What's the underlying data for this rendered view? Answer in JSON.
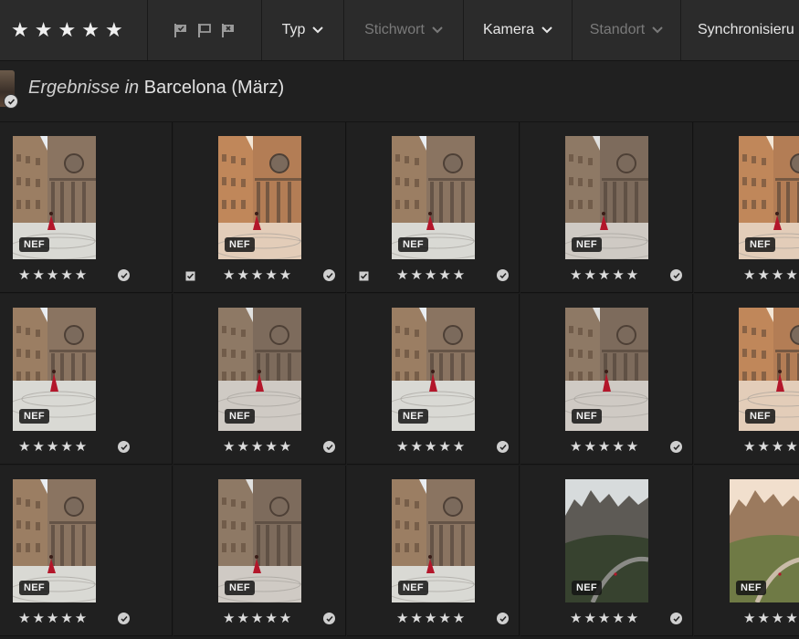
{
  "filter_bar": {
    "stars": [
      "★",
      "★",
      "★",
      "★",
      "★"
    ],
    "flag_icons": [
      "picked-flag-icon",
      "unflagged-icon",
      "rejected-flag-icon"
    ],
    "dropdowns": [
      {
        "label": "Typ",
        "dim": false
      },
      {
        "label": "Stichwort",
        "dim": true
      },
      {
        "label": "Kamera",
        "dim": false
      },
      {
        "label": "Standort",
        "dim": true
      }
    ],
    "sync_label": "Synchronisieru"
  },
  "title": {
    "prefix": "Ergebnisse in",
    "album": "Barcelona (März)"
  },
  "photos": [
    {
      "badge": "NEF",
      "rating": "★★★★★",
      "scene": "plaza",
      "tone": "cool",
      "picked": false
    },
    {
      "badge": "NEF",
      "rating": "★★★★★",
      "scene": "plaza",
      "tone": "warm",
      "picked": true
    },
    {
      "badge": "NEF",
      "rating": "★★★★★",
      "scene": "plaza",
      "tone": "cool",
      "picked": true
    },
    {
      "badge": "NEF",
      "rating": "★★★★★",
      "scene": "plaza",
      "tone": "muted",
      "picked": false
    },
    {
      "badge": "NEF",
      "rating": "★★★★★",
      "scene": "plaza",
      "tone": "warm",
      "picked": false
    },
    {
      "badge": "NEF",
      "rating": "★★★★★",
      "scene": "plaza2",
      "tone": "cool",
      "picked": false
    },
    {
      "badge": "NEF",
      "rating": "★★★★★",
      "scene": "plaza2",
      "tone": "muted",
      "picked": false
    },
    {
      "badge": "NEF",
      "rating": "★★★★★",
      "scene": "plaza2",
      "tone": "cool",
      "picked": false
    },
    {
      "badge": "NEF",
      "rating": "★★★★★",
      "scene": "plaza2",
      "tone": "muted",
      "picked": false
    },
    {
      "badge": "NEF",
      "rating": "★★★★★",
      "scene": "plaza2",
      "tone": "warm",
      "picked": false
    },
    {
      "badge": "NEF",
      "rating": "★★★★★",
      "scene": "plaza",
      "tone": "cool",
      "picked": false
    },
    {
      "badge": "NEF",
      "rating": "★★★★★",
      "scene": "plaza",
      "tone": "muted",
      "picked": false
    },
    {
      "badge": "NEF",
      "rating": "★★★★★",
      "scene": "plaza",
      "tone": "cool",
      "picked": false
    },
    {
      "badge": "NEF",
      "rating": "★★★★★",
      "scene": "mountain",
      "tone": "dark",
      "picked": false
    },
    {
      "badge": "NEF",
      "rating": "★★★★★",
      "scene": "mountain",
      "tone": "warm",
      "picked": false
    }
  ]
}
